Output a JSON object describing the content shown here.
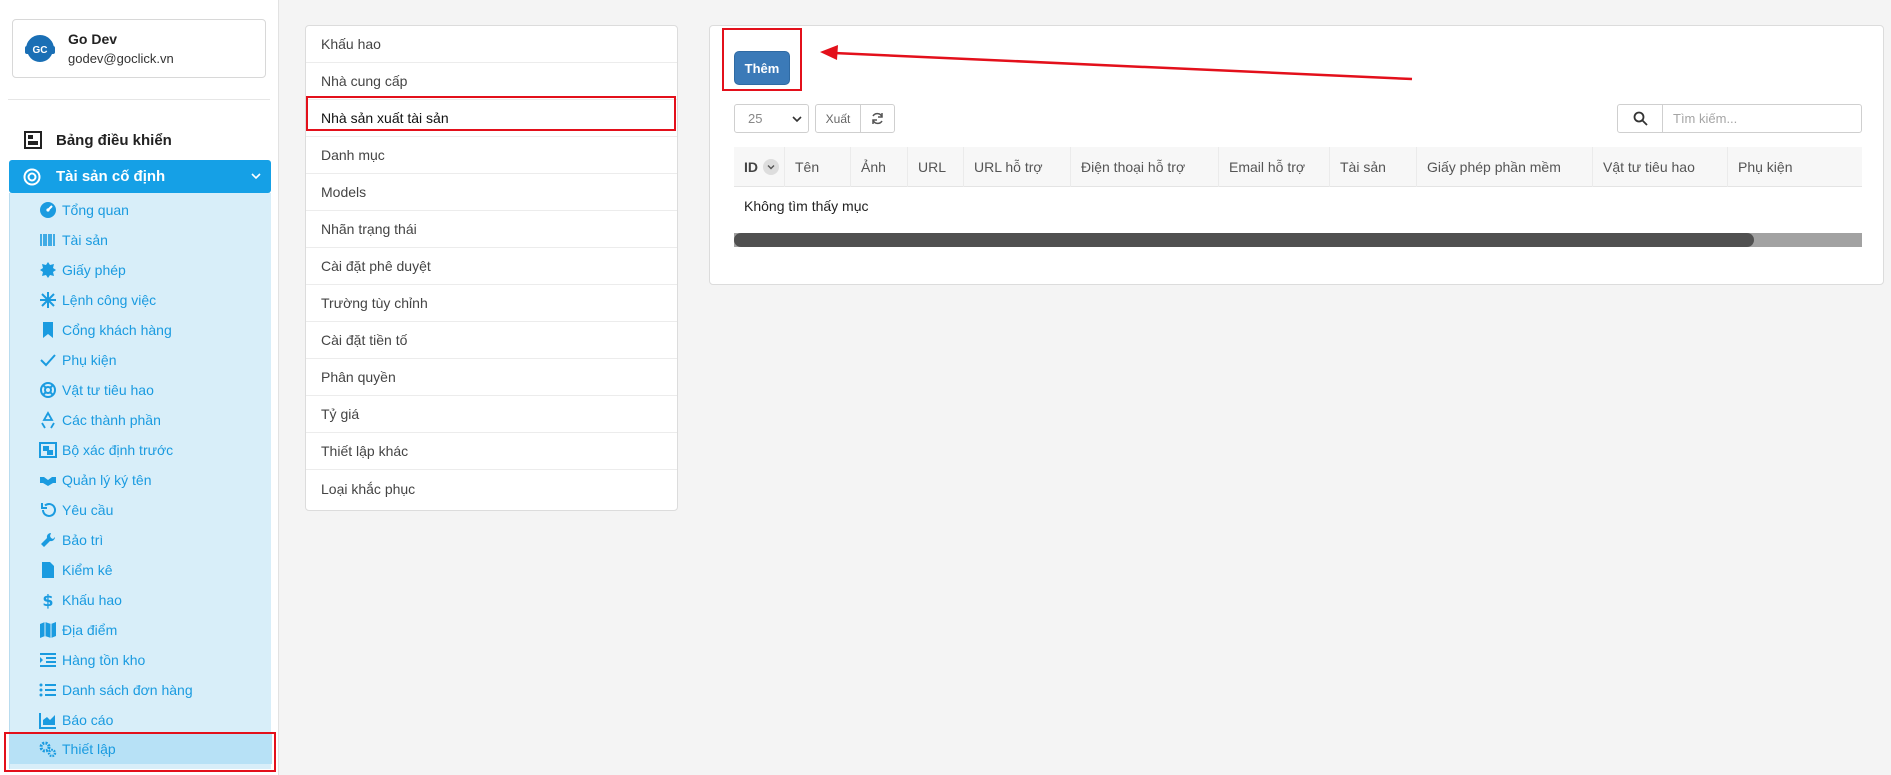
{
  "user": {
    "name": "Go Dev",
    "email": "godev@goclick.vn",
    "avatar_text": "GC"
  },
  "nav": {
    "dashboard": "Bảng điều khiển",
    "group": "Tài sản cố định",
    "items": [
      {
        "label": "Tổng quan",
        "icon": "dashboard-gauge-icon"
      },
      {
        "label": "Tài sản",
        "icon": "barcode-icon"
      },
      {
        "label": "Giấy phép",
        "icon": "certificate-icon"
      },
      {
        "label": "Lệnh công việc",
        "icon": "snowflake-icon"
      },
      {
        "label": "Cổng khách hàng",
        "icon": "bookmark-icon"
      },
      {
        "label": "Phụ kiện",
        "icon": "check-icon"
      },
      {
        "label": "Vật tư tiêu hao",
        "icon": "life-ring-icon"
      },
      {
        "label": "Các thành phần",
        "icon": "recycle-icon"
      },
      {
        "label": "Bộ xác định trước",
        "icon": "object-group-icon"
      },
      {
        "label": "Quản lý ký tên",
        "icon": "handshake-icon"
      },
      {
        "label": "Yêu cầu",
        "icon": "undo-icon"
      },
      {
        "label": "Bảo trì",
        "icon": "wrench-icon"
      },
      {
        "label": "Kiểm kê",
        "icon": "file-icon"
      },
      {
        "label": "Khấu hao",
        "icon": "dollar-icon"
      },
      {
        "label": "Địa điểm",
        "icon": "map-icon"
      },
      {
        "label": "Hàng tồn kho",
        "icon": "indent-icon"
      },
      {
        "label": "Danh sách đơn hàng",
        "icon": "list-icon"
      },
      {
        "label": "Báo cáo",
        "icon": "area-chart-icon"
      },
      {
        "label": "Thiết lập",
        "icon": "cogs-icon"
      }
    ]
  },
  "settings_menu": [
    "Khấu hao",
    "Nhà cung cấp",
    "Nhà sản xuất tài sản",
    "Danh mục",
    "Models",
    "Nhãn trạng thái",
    "Cài đặt phê duyệt",
    "Trường tùy chỉnh",
    "Cài đặt tiền tố",
    "Phân quyền",
    "Tỷ giá",
    "Thiết lập khác",
    "Loại khắc phục"
  ],
  "toolbar": {
    "add_label": "Thêm",
    "page_size": "25",
    "export_label": "Xuất",
    "search_placeholder": "Tìm kiếm..."
  },
  "table": {
    "columns": [
      "ID",
      "Tên",
      "Ảnh",
      "URL",
      "URL hỗ trợ",
      "Điện thoại hỗ trợ",
      "Email hỗ trợ",
      "Tài sản",
      "Giấy phép phần mềm",
      "Vật tư tiêu hao",
      "Phụ kiện"
    ],
    "empty_message": "Không tìm thấy mục"
  },
  "colors": {
    "accent": "#15a0e6",
    "button": "#3b7ab8",
    "highlight": "#e3101b"
  }
}
